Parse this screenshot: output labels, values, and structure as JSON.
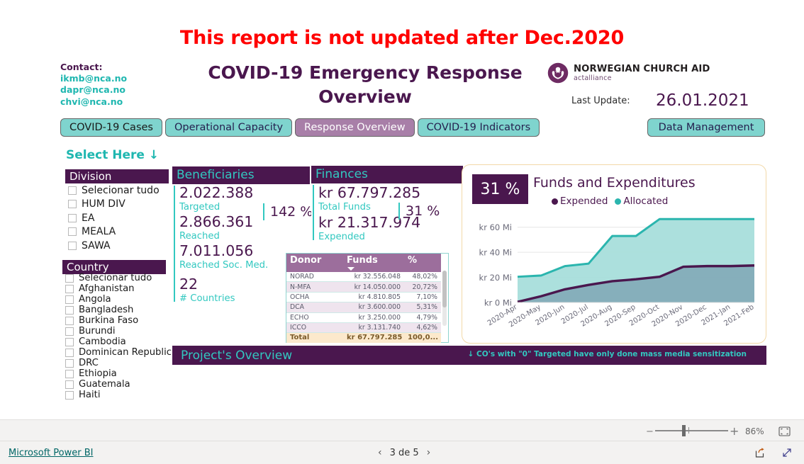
{
  "window": {
    "back_icon": "back-arrow-icon"
  },
  "report": {
    "warning": "This report is not updated after Dec.2020",
    "title": "COVID-19 Emergency Response Overview",
    "contact": {
      "label": "Contact:",
      "emails": [
        "ikmb@nca.no",
        "dapr@nca.no",
        "chvi@nca.no"
      ]
    },
    "logo": {
      "name": "NORWEGIAN CHURCH AID",
      "sub": "actalliance",
      "icon": "nca-dove-hands-icon"
    },
    "last_update": {
      "label": "Last Update:",
      "value": "26.01.2021"
    },
    "tabs": [
      {
        "label": "COVID-19 Cases",
        "active": false
      },
      {
        "label": "Operational Capacity",
        "active": false
      },
      {
        "label": "Response Overview",
        "active": true
      },
      {
        "label": "COVID-19 Indicators",
        "active": false
      }
    ],
    "data_management_button": "Data Management",
    "select_here": "Select Here ↓"
  },
  "slicers": [
    {
      "title": "Division",
      "items": [
        "Selecionar tudo",
        "HUM DIV",
        "EA",
        "MEALA",
        "SAWA"
      ]
    },
    {
      "title": "Country",
      "items": [
        "Selecionar tudo",
        "Afghanistan",
        "Angola",
        "Bangladesh",
        "Burkina Faso",
        "Burundi",
        "Cambodia",
        "Dominican Republic",
        "DRC",
        "Ethiopia",
        "Guatemala",
        "Haiti"
      ]
    }
  ],
  "beneficiaries": {
    "header": "Beneficiaries",
    "metrics": [
      {
        "value": "2.022.388",
        "label": "Targeted"
      },
      {
        "value": "2.866.361",
        "label": "Reached"
      },
      {
        "value": "7.011.056",
        "label": "Reached Soc. Med."
      },
      {
        "value": "22",
        "label": "# Countries"
      }
    ],
    "percent": "142 %"
  },
  "finances": {
    "header": "Finances",
    "metrics": [
      {
        "value": "kr 67.797.285",
        "label": "Total Funds"
      },
      {
        "value": "kr 21.317.974",
        "label": "Expended"
      }
    ],
    "percent": "31 %"
  },
  "donor_table": {
    "columns": [
      "Donor",
      "Funds",
      "%"
    ],
    "sort_column": "Funds",
    "rows": [
      {
        "donor": "NORAD",
        "funds": "kr 32.556.048",
        "pct": "48,02%"
      },
      {
        "donor": "N-MFA",
        "funds": "kr 14.050.000",
        "pct": "20,72%"
      },
      {
        "donor": "OCHA",
        "funds": "kr 4.810.805",
        "pct": "7,10%"
      },
      {
        "donor": "DCA",
        "funds": "kr 3.600.000",
        "pct": "5,31%"
      },
      {
        "donor": "ECHO",
        "funds": "kr 3.250.000",
        "pct": "4,79%"
      },
      {
        "donor": "ICCO",
        "funds": "kr 3.131.740",
        "pct": "4,62%"
      }
    ],
    "total": {
      "donor": "Total",
      "funds": "kr 67.797.285",
      "pct": "100,0..."
    }
  },
  "project_overview_bar": {
    "title": "Project's Overview",
    "note": "↓ CO's with \"0\" Targeted have only done mass media sensitization"
  },
  "zoom_toolbar": {
    "minus": "−",
    "plus": "+",
    "level": "86%",
    "fit_icon": "fit-to-page-icon"
  },
  "footer": {
    "brand": "Microsoft Power BI",
    "prev_icon": "chevron-left-icon",
    "next_icon": "chevron-right-icon",
    "page_text": "3 de 5",
    "share_icon": "share-icon",
    "fullscreen_icon": "fullscreen-icon"
  },
  "colors": {
    "purple": "#4A174E",
    "teal": "#32C8C0",
    "tab_teal": "#7FD4CE",
    "tab_active": "#A87FA8",
    "warning_red": "#FF0000",
    "table_header": "#9C6E9C",
    "total_row": "#FCE9CC"
  },
  "chart_data": {
    "type": "area",
    "title": "Funds and Expenditures",
    "badge": "31 %",
    "xlabel": "",
    "ylabel": "",
    "ylim": [
      0,
      70
    ],
    "ytick_labels": [
      "kr 0 Mi",
      "kr 20 Mi",
      "kr 40 Mi",
      "kr 60 Mi"
    ],
    "ytick_values": [
      0,
      20,
      40,
      60
    ],
    "grid": true,
    "legend_position": "top",
    "categories": [
      "2020-Apr",
      "2020-May",
      "2020-Jun",
      "2020-Jul",
      "2020-Aug",
      "2020-Sep",
      "2020-Oct",
      "2020-Nov",
      "2020-Dec",
      "2021-Jan",
      "2021-Feb"
    ],
    "series": [
      {
        "name": "Allocated",
        "color": "#2BB5AE",
        "fill": "#A8DEDB",
        "values": [
          20.5,
          21.5,
          29.0,
          31.0,
          53.0,
          53.0,
          66.5,
          66.5,
          66.5,
          66.5,
          66.5
        ]
      },
      {
        "name": "Expended",
        "color": "#4A174E",
        "fill": "#7FA6B5",
        "values": [
          0.5,
          5.0,
          10.5,
          14.0,
          17.0,
          18.5,
          20.5,
          28.5,
          29.0,
          29.0,
          29.5
        ]
      }
    ]
  }
}
